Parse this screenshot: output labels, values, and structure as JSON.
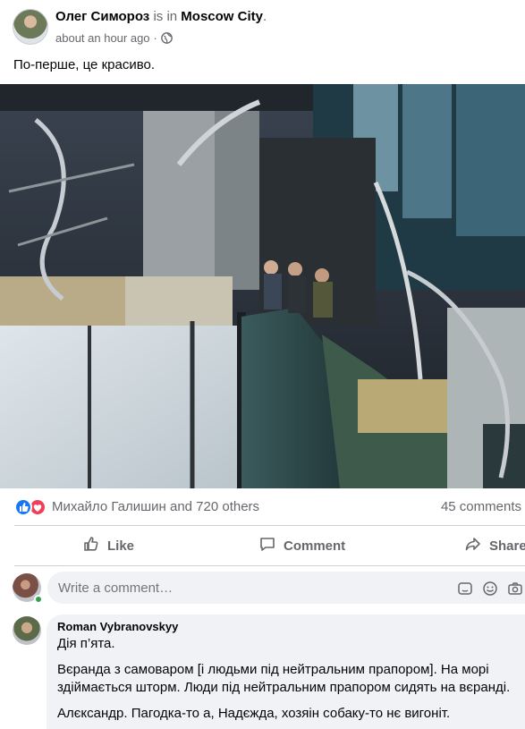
{
  "post": {
    "author": "Олег Симороз",
    "is_in": "is in",
    "place": "Moscow City",
    "period": ".",
    "time": "about an hour ago",
    "separator": "·",
    "text": "По-перше, це красиво."
  },
  "reactions": {
    "reactors_text": "Михайло Галишин and 720 others",
    "comments_count": "45 comments"
  },
  "actions": {
    "like_label": "Like",
    "comment_label": "Comment",
    "share_label": "Share"
  },
  "composer": {
    "placeholder": "Write a comment…"
  },
  "comment": {
    "author": "Roman Vybranovskyy",
    "line1": "Дія п’ята.",
    "line2": "Вєранда з самоваром [і людьми під нейтральним прапором]. На морі здіймається шторм. Люди під нейтральним прапором сидять на вєранді.",
    "line3": "Алєксандр. Пагодка-то а, Надєжда, хозяін собаку-то нє вигоніт."
  },
  "colors": {
    "text_primary": "#050505",
    "text_secondary": "#65676b",
    "like_blue": "#1877f2",
    "love_red": "#f33e58",
    "bubble_bg": "#f0f2f5",
    "online_green": "#31a24c"
  },
  "icons": [
    "globe-icon",
    "like-reaction-icon",
    "love-reaction-icon",
    "thumbs-up-icon",
    "comment-icon",
    "share-icon",
    "emoji-sticker-icon",
    "smiley-icon",
    "camera-icon"
  ]
}
